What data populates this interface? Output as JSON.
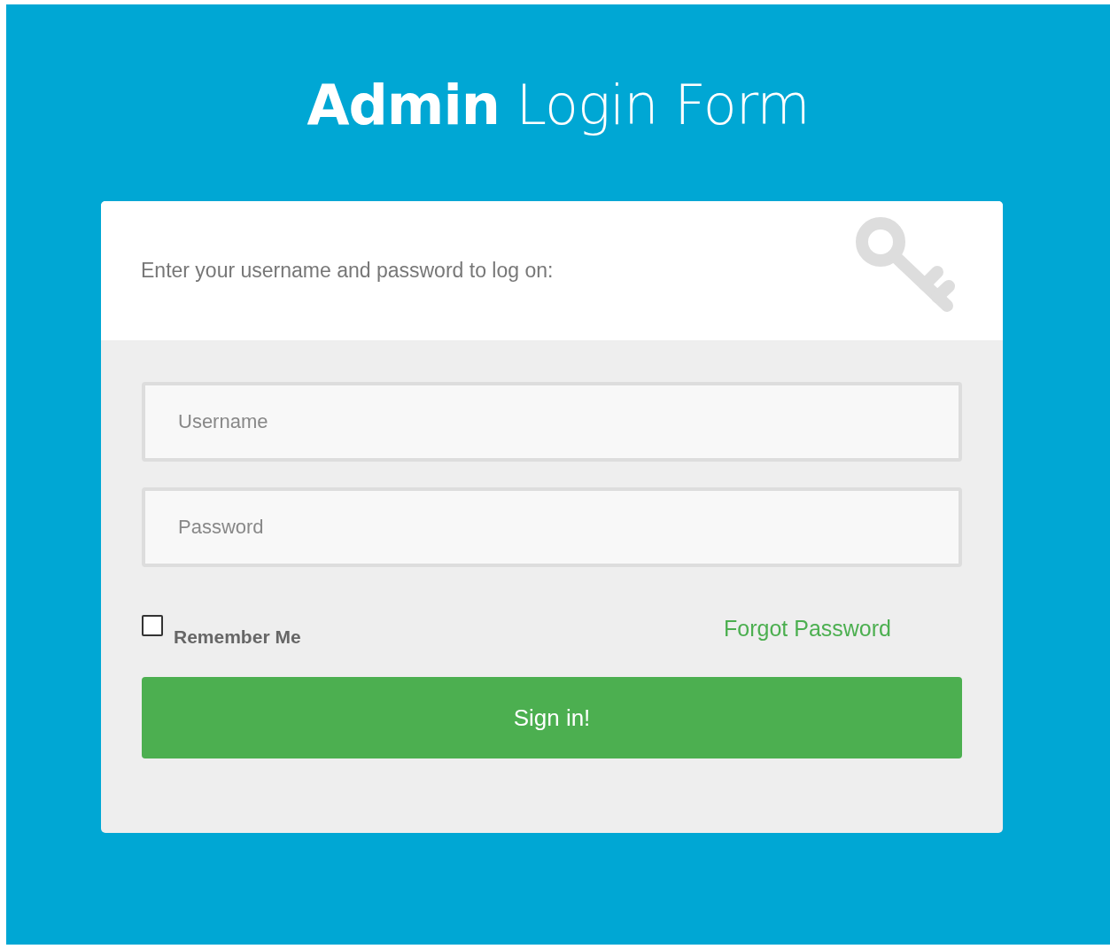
{
  "title": "**Admin** Login Form",
  "card": {
    "prompt": "Enter your username and password to log on:"
  },
  "fields": [
    {
      "placeholder": "Username"
    },
    {
      "placeholder": "Password"
    }
  ],
  "remember": {
    "label": "Remember Me",
    "checked": false
  },
  "forgot_link": "Forgot Password",
  "submit_button": "Sign in!"
}
